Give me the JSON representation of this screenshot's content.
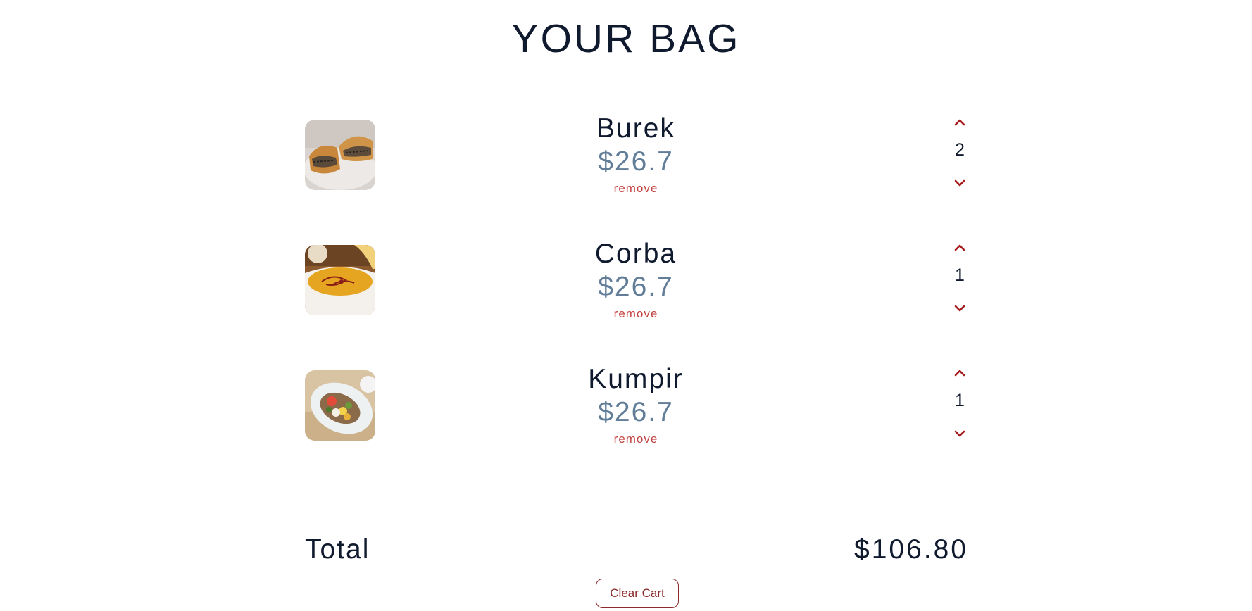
{
  "page": {
    "title": "YOUR BAG"
  },
  "cart": {
    "items": [
      {
        "name": "Burek",
        "price": "$26.7",
        "quantity": "2",
        "remove_label": "remove",
        "image": "burek-photo"
      },
      {
        "name": "Corba",
        "price": "$26.7",
        "quantity": "1",
        "remove_label": "remove",
        "image": "corba-soup-photo"
      },
      {
        "name": "Kumpir",
        "price": "$26.7",
        "quantity": "1",
        "remove_label": "remove",
        "image": "kumpir-potato-photo"
      }
    ],
    "total_label": "Total",
    "total_value": "$106.80",
    "clear_label": "Clear Cart"
  },
  "icons": {
    "increase": "chevron-up-icon",
    "decrease": "chevron-down-icon"
  },
  "colors": {
    "heading": "#101a2e",
    "price": "#617d98",
    "accent": "#c3423f",
    "chevron": "#a61b1b",
    "clear_border": "#8b2a2a"
  }
}
